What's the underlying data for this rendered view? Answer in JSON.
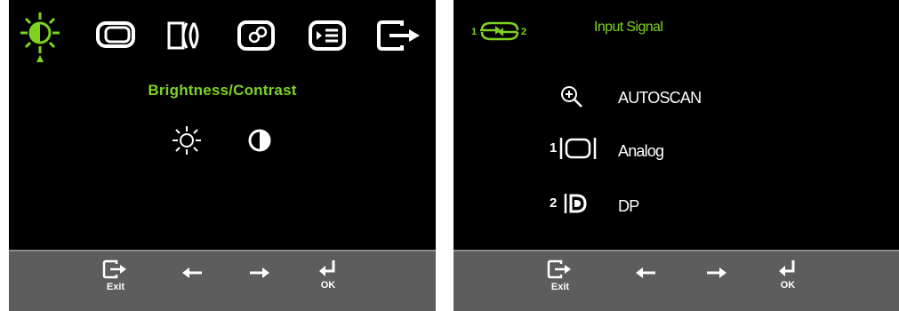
{
  "left_menu": {
    "title": "Brightness/Contrast",
    "top_icons": [
      "brightness-icon",
      "monitor-position-icon",
      "image-setup-icon",
      "color-setup-icon",
      "input-signal-icon",
      "exit-menu-icon"
    ],
    "selected_index": 0,
    "sub_icons": [
      "sun-icon",
      "contrast-icon"
    ]
  },
  "right_menu": {
    "title": "Input Signal",
    "header_icon": "input-switch-icon",
    "options": [
      {
        "icon": "zoom-in-icon",
        "label": "AUTOSCAN"
      },
      {
        "icon": "analog-input-icon",
        "number": "1",
        "label": "Analog"
      },
      {
        "icon": "dp-input-icon",
        "number": "2",
        "label": "DP"
      }
    ]
  },
  "bottom_bar": {
    "exit_label": "Exit",
    "ok_label": "OK"
  },
  "colors": {
    "accent_green": "#7ed321",
    "panel_bg": "#000000",
    "bar_bg": "#5d5d5d"
  }
}
